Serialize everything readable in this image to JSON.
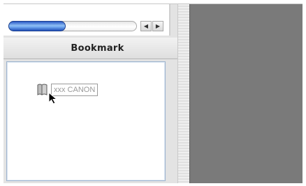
{
  "header": {
    "title": "Bookmark"
  },
  "scrollbar": {
    "left_arrow": "◀",
    "right_arrow": "▶",
    "position": 0.0
  },
  "bookmarks": {
    "items": [
      {
        "label": "xxx CANON",
        "icon": "book-icon"
      }
    ]
  },
  "colors": {
    "workspace_gray": "#7a7a7a",
    "scroll_thumb": "#5b8fe6"
  }
}
